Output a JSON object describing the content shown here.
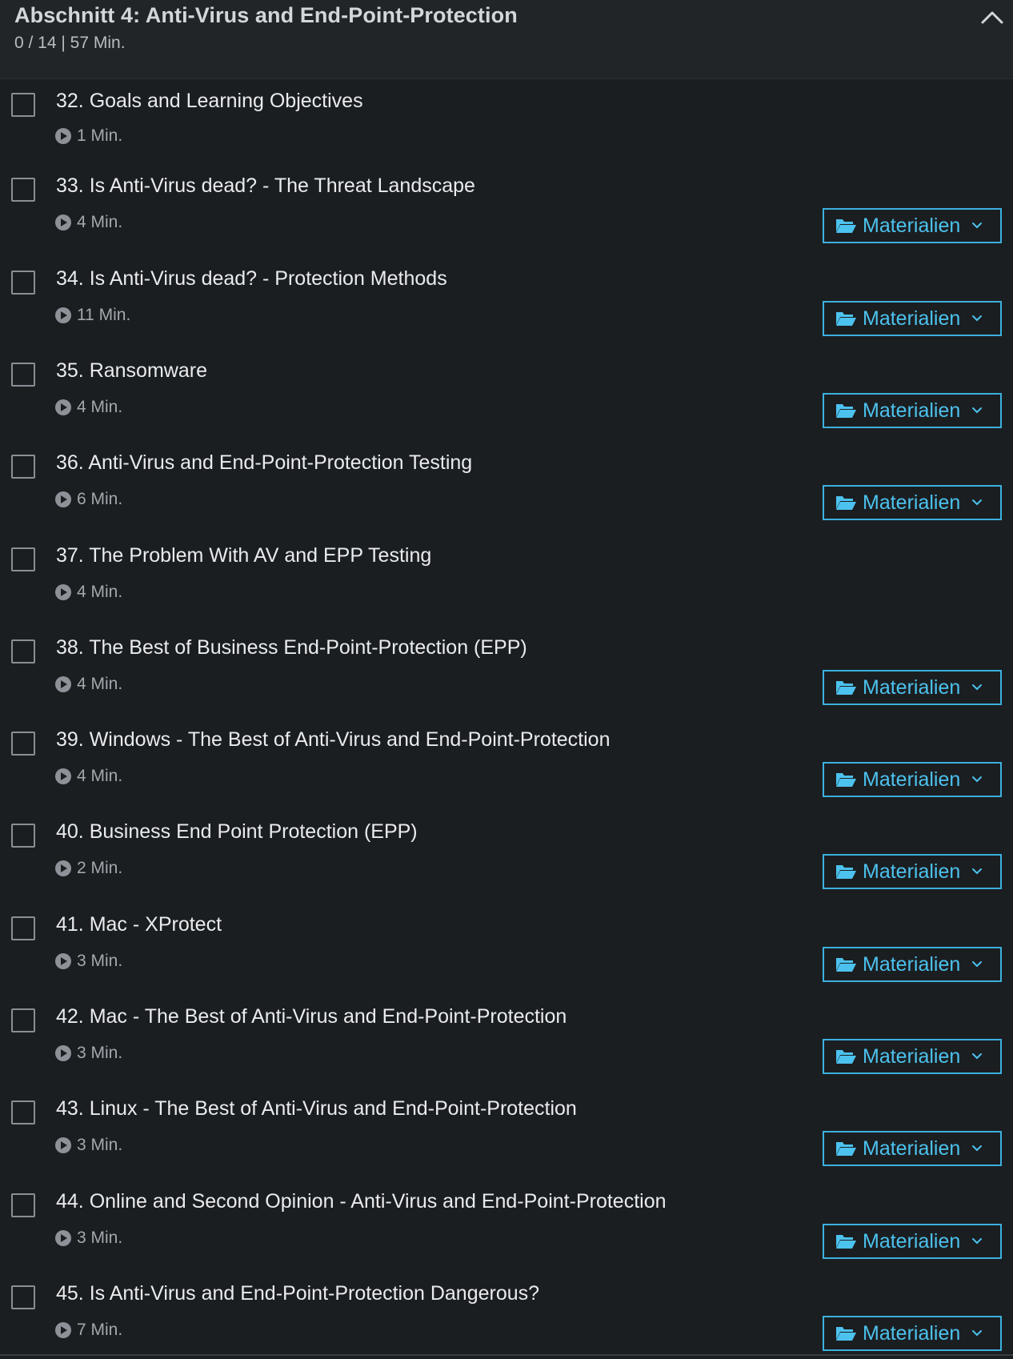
{
  "section": {
    "title": "Abschnitt 4: Anti-Virus and End-Point-Protection",
    "meta": "0 / 14 | 57 Min."
  },
  "colors": {
    "background": "#1b1e21",
    "header_background": "#222528",
    "accent": "#4cc2ee"
  },
  "icons": {
    "collapse": "chevron-up-icon",
    "play": "play-circle-icon",
    "folder": "folder-open-icon",
    "dropdown": "chevron-down-icon"
  },
  "lectures": [
    {
      "title": "32. Goals and Learning Objectives",
      "duration": "1 Min.",
      "has_materials": false
    },
    {
      "title": "33. Is Anti-Virus dead? - The Threat Landscape",
      "duration": "4 Min.",
      "has_materials": true
    },
    {
      "title": "34. Is Anti-Virus dead? - Protection Methods",
      "duration": "11 Min.",
      "has_materials": true
    },
    {
      "title": "35. Ransomware",
      "duration": "4 Min.",
      "has_materials": true
    },
    {
      "title": "36. Anti-Virus and End-Point-Protection Testing",
      "duration": "6 Min.",
      "has_materials": true
    },
    {
      "title": "37. The Problem With AV and EPP Testing",
      "duration": "4 Min.",
      "has_materials": false
    },
    {
      "title": "38. The Best of Business End-Point-Protection (EPP)",
      "duration": "4 Min.",
      "has_materials": true
    },
    {
      "title": "39. Windows - The Best of Anti-Virus and End-Point-Protection",
      "duration": "4 Min.",
      "has_materials": true
    },
    {
      "title": "40. Business End Point Protection (EPP)",
      "duration": "2 Min.",
      "has_materials": true
    },
    {
      "title": "41. Mac - XProtect",
      "duration": "3 Min.",
      "has_materials": true
    },
    {
      "title": "42. Mac - The Best of Anti-Virus and End-Point-Protection",
      "duration": "3 Min.",
      "has_materials": true
    },
    {
      "title": "43. Linux - The Best of Anti-Virus and End-Point-Protection",
      "duration": "3 Min.",
      "has_materials": true
    },
    {
      "title": "44. Online and Second Opinion - Anti-Virus and End-Point-Protection",
      "duration": "3 Min.",
      "has_materials": true
    },
    {
      "title": "45. Is Anti-Virus and End-Point-Protection Dangerous?",
      "duration": "7 Min.",
      "has_materials": true
    }
  ],
  "materials_label": "Materialien"
}
